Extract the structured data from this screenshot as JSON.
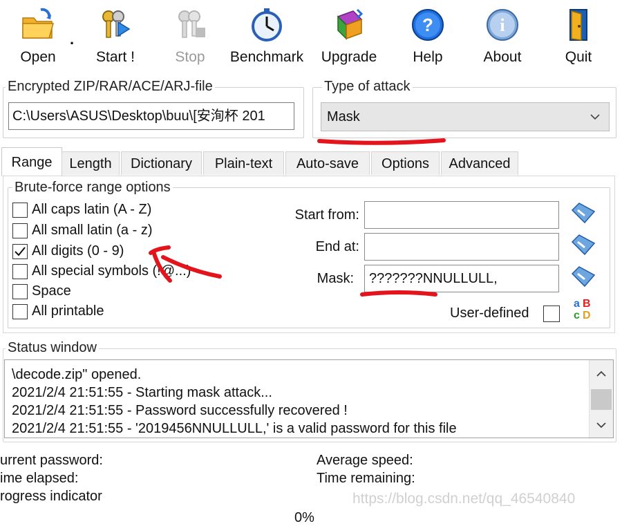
{
  "toolbar": {
    "open": "Open",
    "start": "Start !",
    "stop": "Stop",
    "benchmark": "Benchmark",
    "upgrade": "Upgrade",
    "help": "Help",
    "about": "About",
    "quit": "Quit",
    "open_dropdown": "."
  },
  "file": {
    "group_label": "Encrypted ZIP/RAR/ACE/ARJ-file",
    "path": "C:\\Users\\ASUS\\Desktop\\buu\\[安洵杯 201"
  },
  "attack": {
    "group_label": "Type of attack",
    "selected": "Mask"
  },
  "tabs": [
    "Range",
    "Length",
    "Dictionary",
    "Plain-text",
    "Auto-save",
    "Options",
    "Advanced"
  ],
  "range": {
    "group_label": "Brute-force range options",
    "options": [
      {
        "label": "All caps latin (A - Z)",
        "checked": false
      },
      {
        "label": "All small latin (a - z)",
        "checked": false
      },
      {
        "label": "All digits (0 - 9)",
        "checked": true
      },
      {
        "label": "All special symbols (!@...)",
        "checked": false
      },
      {
        "label": "Space",
        "checked": false
      },
      {
        "label": "All printable",
        "checked": false
      }
    ],
    "start_from_label": "Start from:",
    "start_from_value": "",
    "end_at_label": "End at:",
    "end_at_value": "",
    "mask_label": "Mask:",
    "mask_value": "???????NNULLULL,",
    "user_defined_label": "User-defined",
    "user_defined_checked": false
  },
  "status": {
    "group_label": "Status window",
    "lines": [
      "\\decode.zip\" opened.",
      "2021/2/4 21:51:55 - Starting mask attack...",
      "2021/2/4 21:51:55 - Password successfully recovered !",
      "2021/2/4 21:51:55 - '2019456NNULLULL,' is a valid password for this file"
    ]
  },
  "footer": {
    "current_password": "urrent password:",
    "time_elapsed": "ime elapsed:",
    "progress_indicator": "rogress indicator",
    "average_speed": "Average speed:",
    "time_remaining": "Time remaining:",
    "progress_percent": "0%",
    "watermark": "https://blog.csdn.net/qq_46540840"
  },
  "colors": {
    "annotation_red": "#e3141c",
    "tab_bg": "#f0f0f0",
    "select_bg": "#e6e6e6"
  }
}
